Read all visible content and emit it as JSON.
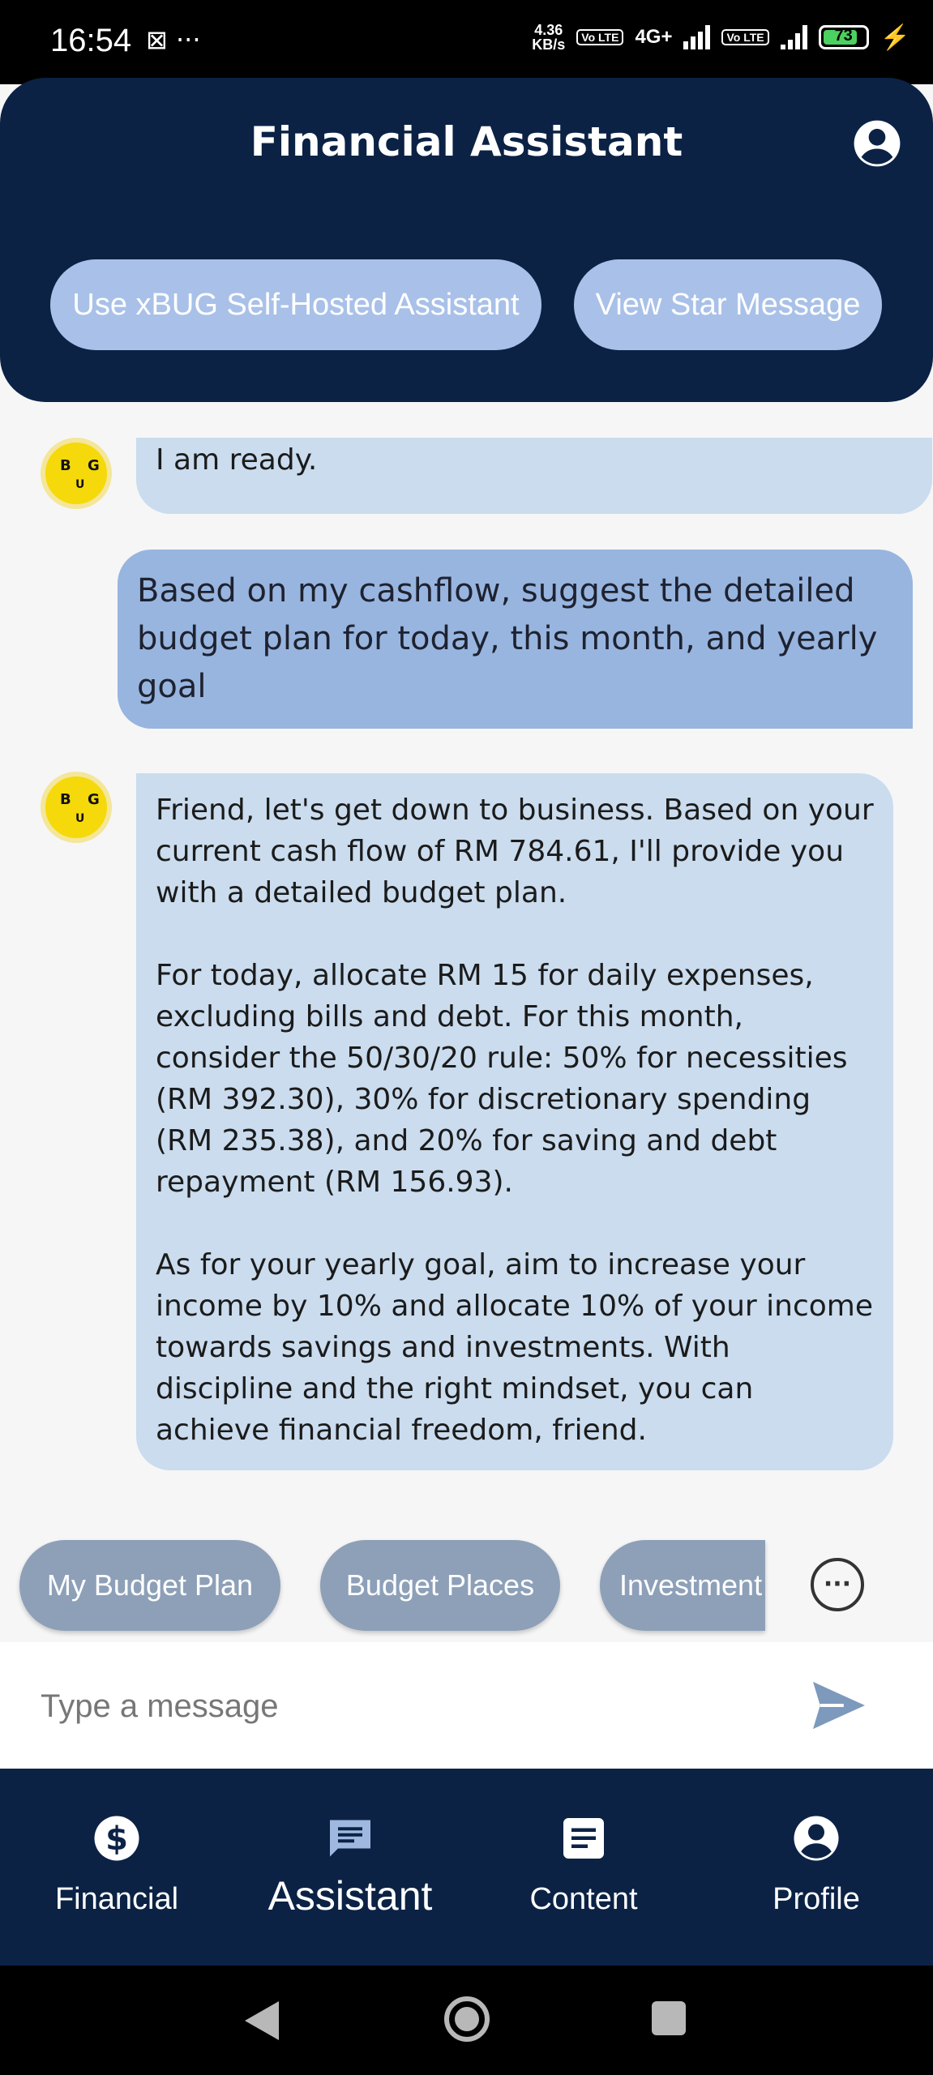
{
  "status_bar": {
    "time": "16:54",
    "left_icons": "⊠ ···",
    "net_speed_value": "4.36",
    "net_speed_unit": "KB/s",
    "sim1_label": "Vo LTE",
    "network_type": "4G+",
    "sim2_label": "Vo LTE",
    "battery_level": "73"
  },
  "header": {
    "title": "Financial Assistant",
    "buttons": {
      "self_hosted": "Use xBUG Self-Hosted Assistant",
      "star_message": "View Star Message"
    }
  },
  "avatar": {
    "letters": [
      "B",
      "G",
      "U"
    ]
  },
  "messages": [
    {
      "sender": "bot",
      "paragraphs": [
        "I am ready."
      ]
    },
    {
      "sender": "user",
      "paragraphs": [
        "Based on my cashflow, suggest the detailed budget plan for today, this month, and yearly goal"
      ]
    },
    {
      "sender": "bot",
      "paragraphs": [
        "Friend, let's get down to business. Based on your current cash flow of RM 784.61, I'll provide you with a detailed budget plan.",
        "For today, allocate RM 15 for daily expenses, excluding bills and debt. For this month, consider the 50/30/20 rule: 50% for necessities (RM 392.30), 30% for discretionary spending (RM 235.38), and 20% for saving and debt repayment (RM 156.93).",
        "As for your yearly goal, aim to increase your income by 10% and allocate 10% of your income towards savings and investments. With discipline and the right mindset, you can achieve financial freedom, friend."
      ]
    }
  ],
  "quick_replies": [
    "My Budget Plan",
    "Budget Places",
    "Investment"
  ],
  "input": {
    "placeholder": "Type a message",
    "value": ""
  },
  "bottom_nav": [
    {
      "label": "Financial",
      "icon": "dollar-icon",
      "active": false
    },
    {
      "label": "Assistant",
      "icon": "chat-icon",
      "active": true
    },
    {
      "label": "Content",
      "icon": "document-icon",
      "active": false
    },
    {
      "label": "Profile",
      "icon": "account-icon",
      "active": false
    }
  ],
  "colors": {
    "navy": "#0b2245",
    "header_button": "#a9c1e8",
    "bot_bubble": "#cadcee",
    "user_bubble": "#98b5df",
    "chip": "#8da0b8",
    "active_nav_icon": "#9fb8e0"
  }
}
